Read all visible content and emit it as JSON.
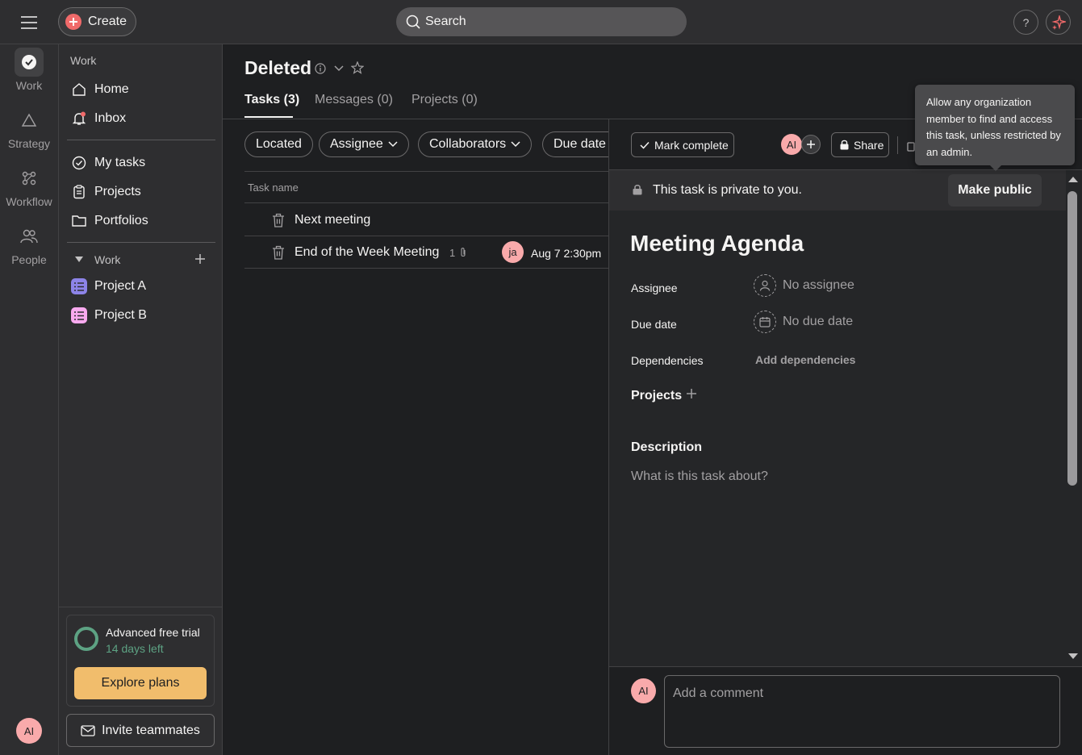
{
  "topbar": {
    "create_label": "Create",
    "search_placeholder": "Search",
    "help_label": "?"
  },
  "rail": {
    "items": [
      {
        "label": "Work",
        "icon": "check-circle-icon"
      },
      {
        "label": "Strategy",
        "icon": "triangle-icon"
      },
      {
        "label": "Workflow",
        "icon": "workflow-icon"
      },
      {
        "label": "People",
        "icon": "people-icon"
      }
    ],
    "avatar_initials": "AI"
  },
  "sidebar": {
    "section_work": "Work",
    "home": "Home",
    "inbox": "Inbox",
    "my_tasks": "My tasks",
    "projects": "Projects",
    "portfolios": "Portfolios",
    "team_section": "Work",
    "project_items": [
      {
        "label": "Project A",
        "color": "#8d84e8"
      },
      {
        "label": "Project B",
        "color": "#f9aaef"
      }
    ],
    "trial_title": "Advanced free trial",
    "trial_days": "14 days left",
    "explore_label": "Explore plans",
    "invite_label": "Invite teammates"
  },
  "main": {
    "title": "Deleted",
    "tabs": [
      {
        "label": "Tasks (3)",
        "active": true
      },
      {
        "label": "Messages (0)",
        "active": false
      },
      {
        "label": "Projects (0)",
        "active": false
      }
    ],
    "filters": [
      "Located",
      "Assignee",
      "Collaborators",
      "Due date"
    ],
    "column_task_name": "Task name",
    "tasks": [
      {
        "name": "Next meeting"
      },
      {
        "name": "End of the Week Meeting",
        "attachments": "1",
        "assignee_initials": "ja",
        "due": "Aug 7 2:30pm"
      }
    ]
  },
  "detail": {
    "mark_complete": "Mark complete",
    "collaborator_initials": "AI",
    "share_label": "Share",
    "private_text": "This task is private to you.",
    "make_public": "Make public",
    "tooltip": "Allow any organization member to find and access this task, unless restricted by an admin.",
    "task_title": "Meeting Agenda",
    "assignee_label": "Assignee",
    "assignee_value": "No assignee",
    "due_label": "Due date",
    "due_value": "No due date",
    "deps_label": "Dependencies",
    "deps_value": "Add dependencies",
    "projects_label": "Projects",
    "description_label": "Description",
    "description_placeholder": "What is this task about?",
    "comment_initials": "AI",
    "comment_placeholder": "Add a comment"
  },
  "colors": {
    "accent": "#f06a6a",
    "trial": "#5da283",
    "explore": "#f1bd6c",
    "avatar": "#f9aaab"
  }
}
